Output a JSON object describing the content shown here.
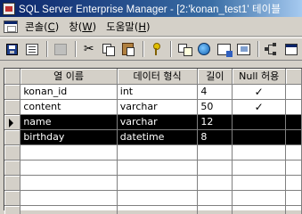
{
  "window": {
    "title": "SQL Server Enterprise Manager - [2:'konan_test1' 테이블"
  },
  "menu": {
    "items": [
      {
        "label": "콘솔(",
        "key": "C",
        "suffix": ")"
      },
      {
        "label": "창(",
        "key": "W",
        "suffix": ")"
      },
      {
        "label": "도움말(",
        "key": "H",
        "suffix": ")"
      }
    ]
  },
  "toolbar": {
    "buttons": [
      {
        "name": "save-icon"
      },
      {
        "name": "properties-icon"
      },
      {
        "name": "generate-script-icon"
      },
      {
        "name": "cut-icon"
      },
      {
        "name": "copy-icon"
      },
      {
        "name": "paste-icon"
      },
      {
        "name": "primary-key-icon"
      },
      {
        "name": "relationships-icon"
      },
      {
        "name": "globe-icon"
      },
      {
        "name": "indexes-icon"
      },
      {
        "name": "constraints-icon"
      },
      {
        "name": "tree-icon"
      },
      {
        "name": "window-icon"
      }
    ]
  },
  "grid": {
    "columns": [
      "열 이름",
      "데이터 형식",
      "길이",
      "Null 허용"
    ],
    "rows": [
      {
        "name": "konan_id",
        "type": "int",
        "length": "4",
        "nullable": "✓",
        "selected": false
      },
      {
        "name": "content",
        "type": "varchar",
        "length": "50",
        "nullable": "✓",
        "selected": false
      },
      {
        "name": "name",
        "type": "varchar",
        "length": "12",
        "nullable": "",
        "selected": true,
        "current": true
      },
      {
        "name": "birthday",
        "type": "datetime",
        "length": "8",
        "nullable": "",
        "selected": true
      }
    ],
    "empty_row_count": 5
  },
  "colors": {
    "selection": "#000000",
    "titlebar_start": "#0a246a"
  }
}
